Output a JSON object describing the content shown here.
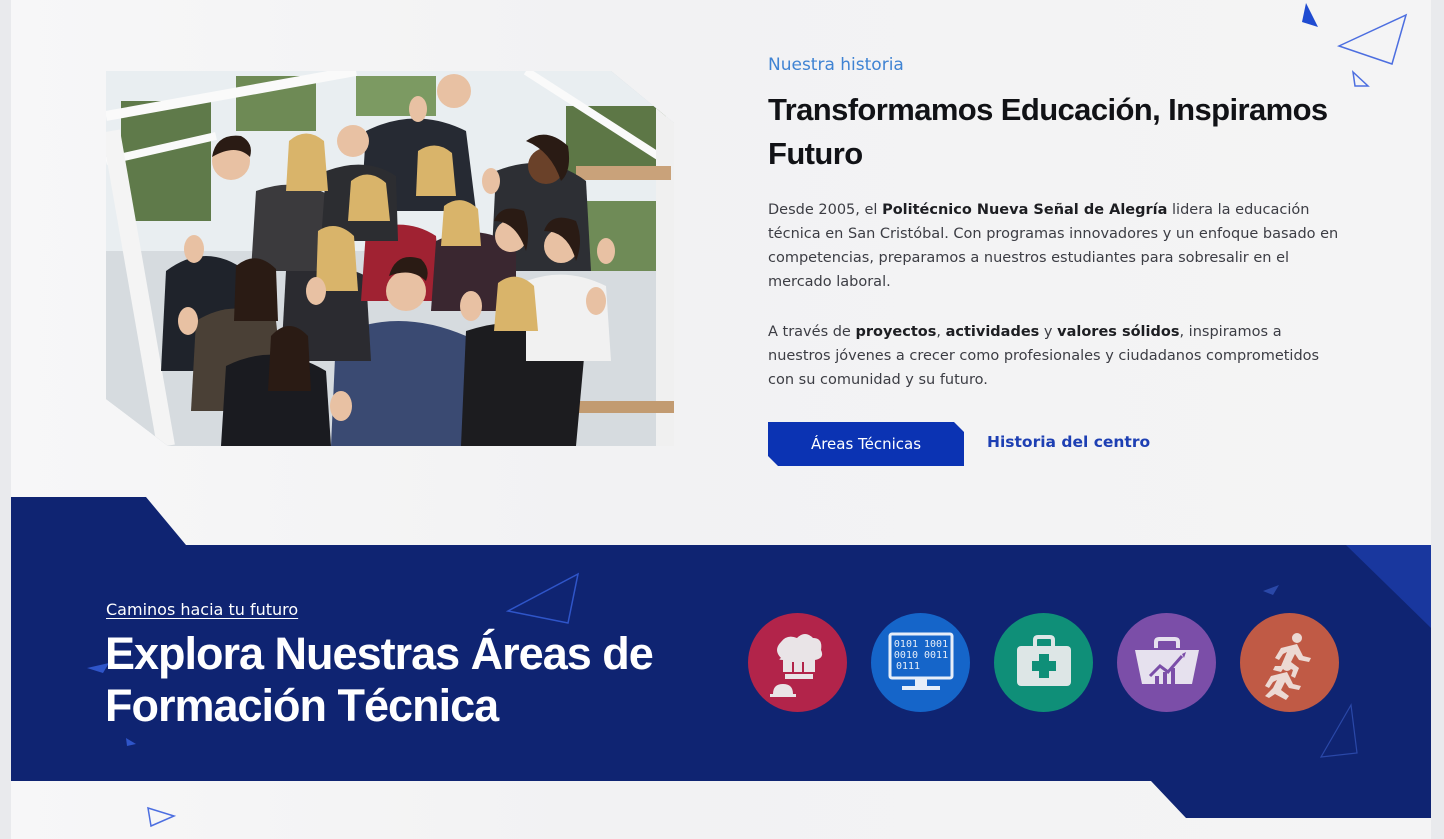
{
  "about": {
    "kicker": "Nuestra historia",
    "title": "Transformamos Educación, Inspiramos Futuro",
    "p1_a": "Desde 2005, el ",
    "p1_b": "Politécnico Nueva Señal de Alegría",
    "p1_c": " lidera la educación técnica en San Cristóbal. Con programas innovadores y un enfoque basado en competencias, preparamos a nuestros estudiantes para sobresalir en el mercado laboral.",
    "p2_a": "A través de ",
    "p2_b": "proyectos",
    "p2_c": ", ",
    "p2_d": "actividades",
    "p2_e": " y ",
    "p2_f": "valores sólidos",
    "p2_g": ", inspiramos a nuestros jóvenes a crecer como profesionales y ciudadanos comprometidos con su comunidad y su futuro.",
    "primary_button": "Áreas Técnicas",
    "secondary_link": "Historia del centro"
  },
  "areas_section": {
    "kicker": "Caminos hacia tu futuro",
    "title": "Explora Nuestras Áreas de Formación Técnica",
    "areas": [
      {
        "icon": "chef-hat-icon",
        "color": "#b2244a"
      },
      {
        "icon": "computer-binary-icon",
        "color": "#1565c9",
        "binary_1": "0101 1001",
        "binary_2": "0010 0011",
        "binary_3": "0111"
      },
      {
        "icon": "first-aid-kit-icon",
        "color": "#0f8f78"
      },
      {
        "icon": "business-chart-folder-icon",
        "color": "#7b4ea8"
      },
      {
        "icon": "running-people-icon",
        "color": "#c05a45"
      }
    ]
  },
  "colors": {
    "accent_blue": "#0b33b3",
    "band_navy": "#0f2472",
    "kicker_blue": "#3f83d3"
  }
}
